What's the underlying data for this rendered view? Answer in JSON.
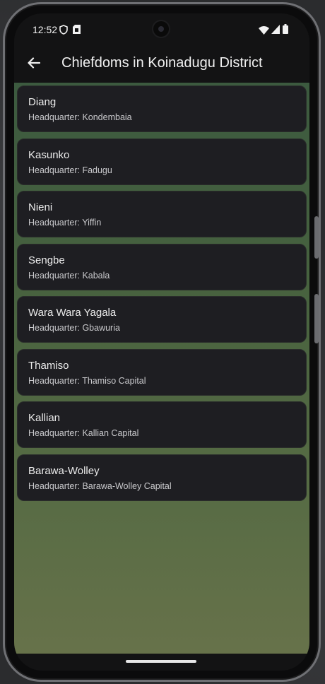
{
  "status_bar": {
    "time": "12:52",
    "icons": [
      "shield-icon",
      "sim-card-icon",
      "wifi-icon",
      "cellular-signal-icon",
      "battery-icon"
    ]
  },
  "app_bar": {
    "back_icon": "arrow-left-icon",
    "title": "Chiefdoms in Koinadugu District"
  },
  "chiefdoms": [
    {
      "name": "Diang",
      "hq_prefix": "Headquarter: ",
      "headquarter": "Kondembaia"
    },
    {
      "name": "Kasunko",
      "hq_prefix": "Headquarter: ",
      "headquarter": "Fadugu"
    },
    {
      "name": "Nieni",
      "hq_prefix": "Headquarter: ",
      "headquarter": "Yiffin"
    },
    {
      "name": "Sengbe",
      "hq_prefix": "Headquarter: ",
      "headquarter": "Kabala"
    },
    {
      "name": "Wara Wara Yagala",
      "hq_prefix": "Headquarter: ",
      "headquarter": "Gbawuria"
    },
    {
      "name": "Thamiso",
      "hq_prefix": "Headquarter: ",
      "headquarter": "Thamiso Capital"
    },
    {
      "name": "Kallian",
      "hq_prefix": "Headquarter: ",
      "headquarter": "Kallian Capital"
    },
    {
      "name": "Barawa-Wolley",
      "hq_prefix": "Headquarter: ",
      "headquarter": "Barawa-Wolley Capital"
    }
  ],
  "colors": {
    "background_top": "#3c5a3f",
    "background_bottom": "#67724a",
    "card": "#1e1e22",
    "app_bar": "#131314"
  }
}
